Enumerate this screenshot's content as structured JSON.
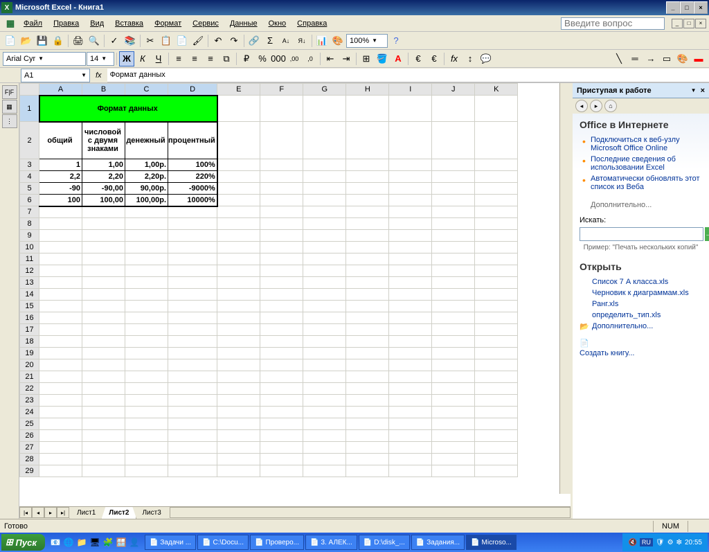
{
  "titlebar": {
    "app": "Microsoft Excel",
    "doc": "Книга1"
  },
  "menubar": {
    "items": [
      "Файл",
      "Правка",
      "Вид",
      "Вставка",
      "Формат",
      "Сервис",
      "Данные",
      "Окно",
      "Справка"
    ],
    "question_placeholder": "Введите вопрос"
  },
  "toolbar2": {
    "font": "Arial Cyr",
    "size": "14",
    "zoom": "100%"
  },
  "formula": {
    "namebox": "A1",
    "fx": "fx",
    "content": "Формат данных"
  },
  "columns": [
    "A",
    "B",
    "C",
    "D",
    "E",
    "F",
    "G",
    "H",
    "I",
    "J",
    "K"
  ],
  "rows_shown": 29,
  "sheet": {
    "r1_title": "Формат данных",
    "r2": {
      "a": "общий",
      "b": "числовой с двумя знаками",
      "c": "денежный",
      "d": "процентный"
    },
    "r3": {
      "a": "1",
      "b": "1,00",
      "c": "1,00р.",
      "d": "100%"
    },
    "r4": {
      "a": "2,2",
      "b": "2,20",
      "c": "2,20р.",
      "d": "220%"
    },
    "r5": {
      "a": "-90",
      "b": "-90,00",
      "c": "90,00р.",
      "d": "-9000%"
    },
    "r6": {
      "a": "100",
      "b": "100,00",
      "c": "100,00р.",
      "d": "10000%"
    }
  },
  "tabs": [
    "Лист1",
    "Лист2",
    "Лист3"
  ],
  "active_tab": 1,
  "taskpane": {
    "title": "Приступая к работе",
    "section1": "Office в Интернете",
    "links": [
      "Подключиться к веб-узлу Microsoft Office Online",
      "Последние сведения об использовании Excel",
      "Автоматически обновлять этот список из Веба"
    ],
    "more": "Дополнительно...",
    "search_label": "Искать:",
    "example": "Пример: \"Печать нескольких копий\"",
    "open": "Открыть",
    "files": [
      "Список 7 А класса.xls",
      "Черновик к диаграммам.xls",
      "Ранг.xls",
      "определить_тип.xls"
    ],
    "more_open": "Дополнительно...",
    "newbook": "Создать книгу..."
  },
  "statusbar": {
    "ready": "Готово",
    "num": "NUM"
  },
  "taskbar": {
    "start": "Пуск",
    "items": [
      "Задачи ...",
      "C:\\Docu...",
      "Проверо...",
      "3. АЛЕК...",
      "D:\\disk_...",
      "Задания...",
      "Microso..."
    ],
    "lang": "RU",
    "time": "20:55"
  }
}
